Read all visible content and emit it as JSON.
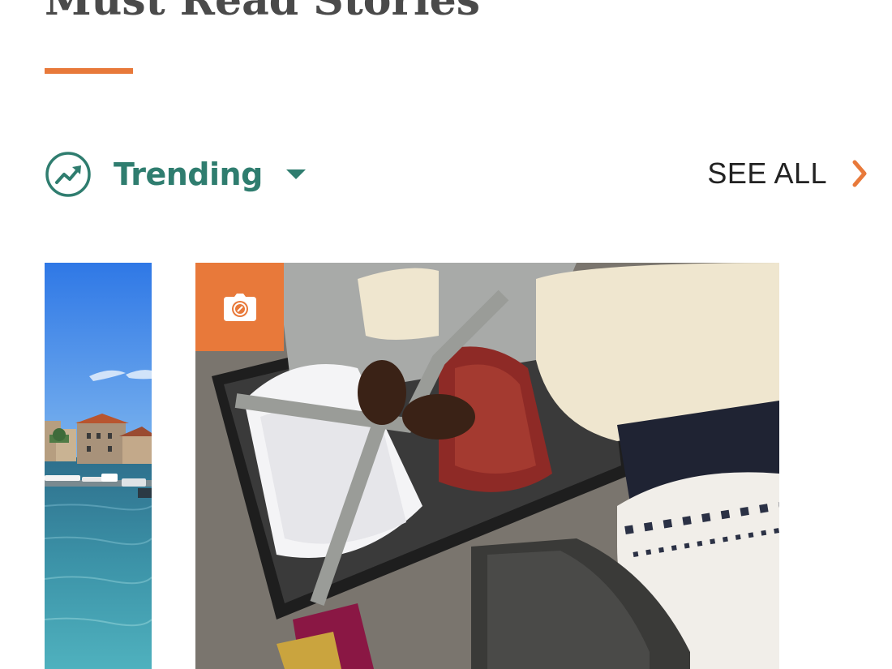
{
  "section": {
    "title": "Must Read Stories"
  },
  "filter": {
    "icon": "trending-up-icon",
    "label": "Trending",
    "caret_icon": "caret-down-icon"
  },
  "see_all": {
    "label": "SEE ALL",
    "icon": "chevron-right-icon"
  },
  "cards": [
    {
      "image": "coastal-harbor-photo"
    },
    {
      "image": "packing-suitcase-photo",
      "badge_icon": "camera-icon"
    }
  ],
  "colors": {
    "accent": "#e8793a",
    "brand_green": "#2f7d6f",
    "title_text": "#4a4a4a"
  }
}
